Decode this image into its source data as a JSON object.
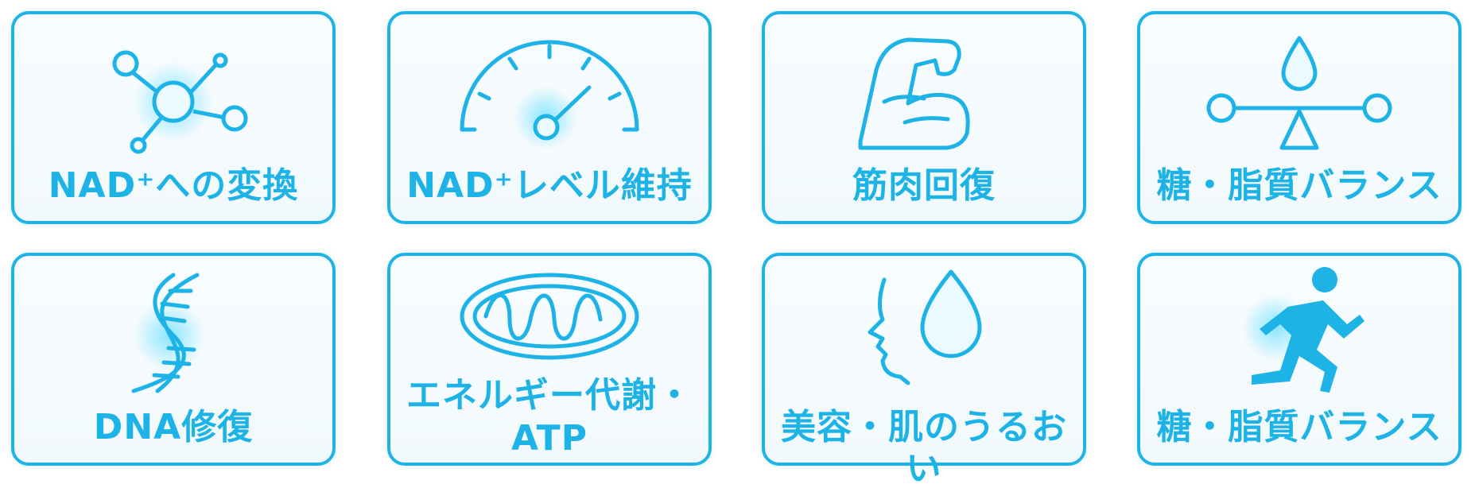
{
  "cards": [
    {
      "label": "NAD⁺への変換",
      "icon": "molecule-icon"
    },
    {
      "label": "NAD⁺レベル維持",
      "icon": "gauge-icon"
    },
    {
      "label": "筋肉回復",
      "icon": "flexed-arm-icon"
    },
    {
      "label": "糖・脂質バランス",
      "icon": "balance-scale-icon"
    },
    {
      "label": "DNA修復",
      "icon": "dna-icon"
    },
    {
      "label_lines": [
        "エネルギー代謝・",
        "ATP"
      ],
      "icon": "mitochondria-icon"
    },
    {
      "label": "美容・肌のうるおい",
      "icon": "face-droplet-icon"
    },
    {
      "label": "糖・脂質バランス",
      "icon": "running-person-icon"
    }
  ],
  "colors": {
    "accent": "#1db3e6",
    "background": "#ffffff",
    "card_fill": "#f5fbfd"
  }
}
